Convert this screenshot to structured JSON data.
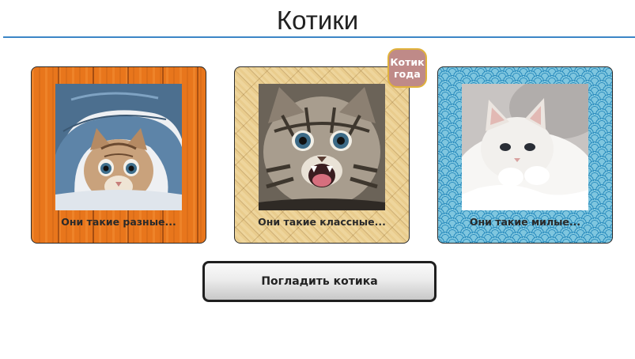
{
  "page": {
    "title": "Котики"
  },
  "cards": [
    {
      "caption": "Они такие разные...",
      "background": "orange-wood",
      "photo_icon": "kitten-in-jeans-photo"
    },
    {
      "caption": "Они такие классные...",
      "background": "parquet",
      "photo_icon": "laughing-tabby-kitten-photo"
    },
    {
      "caption": "Они такие милые...",
      "background": "blue-waves",
      "photo_icon": "white-kitten-photo"
    }
  ],
  "badge": {
    "text_line1": "Котик",
    "text_line2": "года"
  },
  "action": {
    "button_label": "Погладить котика"
  },
  "colors": {
    "title_rule": "#3c86c6",
    "badge_bg": "#bf8a88",
    "badge_border": "#e0b23c"
  }
}
